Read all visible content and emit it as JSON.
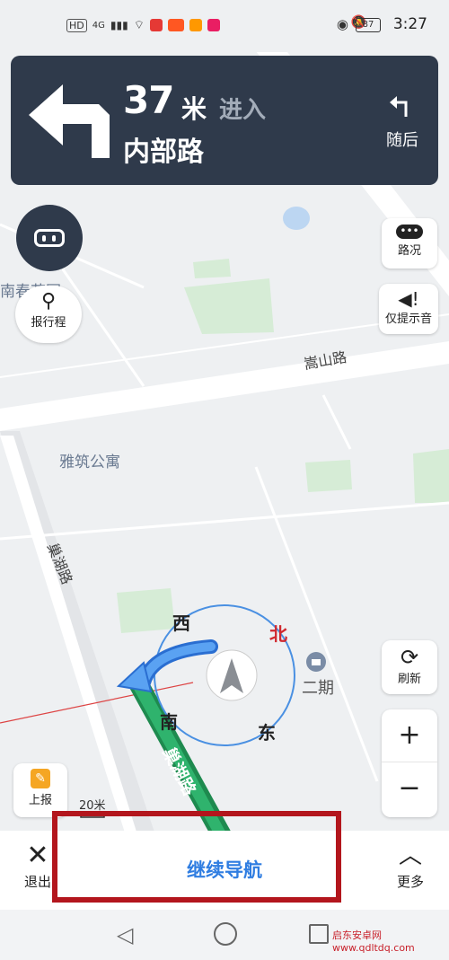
{
  "status": {
    "chips": [
      "HD",
      "4G"
    ],
    "battery": "87",
    "time": "3:27"
  },
  "nav": {
    "distance": "37",
    "unit": "米",
    "action": "进入",
    "road": "内部路",
    "next_label": "随后"
  },
  "buttons": {
    "traffic": "路况",
    "report_trip": "报行程",
    "sound": "仅提示音",
    "refresh": "刷新",
    "zoom_in": "+",
    "zoom_out": "−",
    "report": "上报"
  },
  "map": {
    "labels": {
      "garden": "南春花园",
      "songshan": "嵩山路",
      "yazhu": "雅筑公寓",
      "chaohu1": "巢湖路",
      "chaohu2": "巢湖路",
      "erqi": "二期"
    },
    "compass": {
      "west": "西",
      "north": "北",
      "south": "南",
      "east": "东"
    },
    "scale": "20米"
  },
  "bottom": {
    "exit": "退出",
    "continue": "继续导航",
    "more": "更多"
  },
  "colors": {
    "nav_bg": "#2f3a4b",
    "accent_blue": "#2f7de1",
    "route_green": "#2fb36d",
    "highlight_red": "#b3161d"
  },
  "watermark": "启东安卓网 www.qdltdq.com"
}
